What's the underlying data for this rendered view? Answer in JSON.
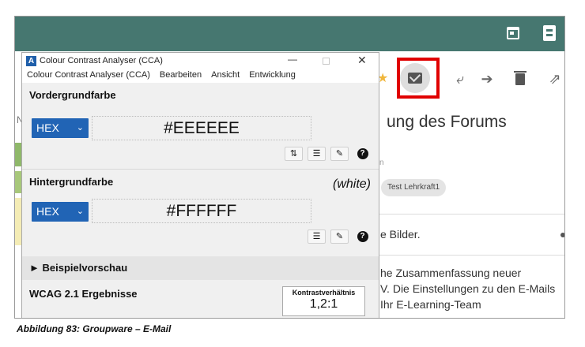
{
  "groupware": {
    "header_icons": [
      "calendar-icon",
      "address-book-icon"
    ],
    "header_color": "#467770",
    "toolbar_icons": [
      "star-icon",
      "mail-move-icon",
      "reply-icon",
      "forward-icon",
      "trash-icon",
      "open-external-icon"
    ],
    "highlight_color": "#e00000",
    "title_fragment": "ung des Forums",
    "small_fragment": "n",
    "tag": "Test Lehrkraft1",
    "line_bilder": "e Bilder.",
    "body_lines": [
      "he Zusammenfassung neuer",
      "V. Die Einstellungen zu den E-Mails",
      "Ihr E-Learning-Team"
    ],
    "left_fragment": "N"
  },
  "cca": {
    "window_title": "Colour Contrast Analyser (CCA)",
    "app_icon_letter": "A",
    "menu": [
      "Colour Contrast Analyser (CCA)",
      "Bearbeiten",
      "Ansicht",
      "Entwicklung"
    ],
    "foreground": {
      "heading": "Vordergrundfarbe",
      "format": "HEX",
      "value": "#EEEEEE",
      "buttons": [
        "swap-icon",
        "sliders-icon",
        "eyedropper-icon",
        "help-icon"
      ]
    },
    "background": {
      "heading": "Hintergrundfarbe",
      "name_label": "(white)",
      "format": "HEX",
      "value": "#FFFFFF",
      "buttons": [
        "sliders-icon",
        "eyedropper-icon",
        "help-icon"
      ]
    },
    "preview": {
      "label": "Beispielvorschau",
      "arrow": "►"
    },
    "wcag": {
      "title": "WCAG 2.1 Ergebnisse",
      "ratio_label": "Kontrastverhältnis",
      "ratio_value": "1,2:1"
    },
    "accent": "#2164b5"
  },
  "caption": "Abbildung 83: Groupware – E-Mail"
}
